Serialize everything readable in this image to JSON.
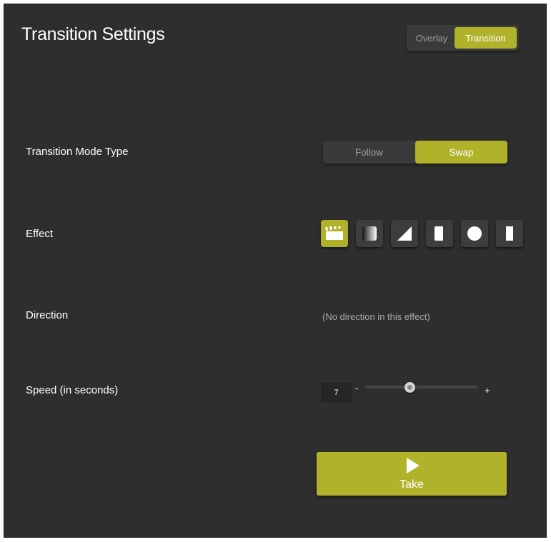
{
  "header": {
    "title": "Transition Settings"
  },
  "tabs": [
    {
      "label": "Overlay",
      "active": false
    },
    {
      "label": "Transition",
      "active": true
    }
  ],
  "transition_mode": {
    "label": "Transition Mode Type",
    "options": [
      {
        "label": "Follow",
        "active": false
      },
      {
        "label": "Swap",
        "active": true
      }
    ]
  },
  "effect": {
    "label": "Effect",
    "options": [
      {
        "icon": "clapperboard-icon",
        "active": true
      },
      {
        "icon": "gradient-fade-icon",
        "active": false
      },
      {
        "icon": "diagonal-wipe-icon",
        "active": false
      },
      {
        "icon": "rounded-bar-icon",
        "active": false
      },
      {
        "icon": "circle-icon",
        "active": false
      },
      {
        "icon": "vertical-bar-icon",
        "active": false
      }
    ]
  },
  "direction": {
    "label": "Direction",
    "note": "(No direction in this effect)"
  },
  "speed": {
    "label": "Speed (in seconds)",
    "value": "7",
    "minus": "-",
    "plus": "+",
    "level": 0.4
  },
  "take": {
    "label": "Take"
  },
  "colors": {
    "accent": "#b0b22a",
    "panel": "#2e2e2e",
    "button": "#3d3d3d"
  }
}
